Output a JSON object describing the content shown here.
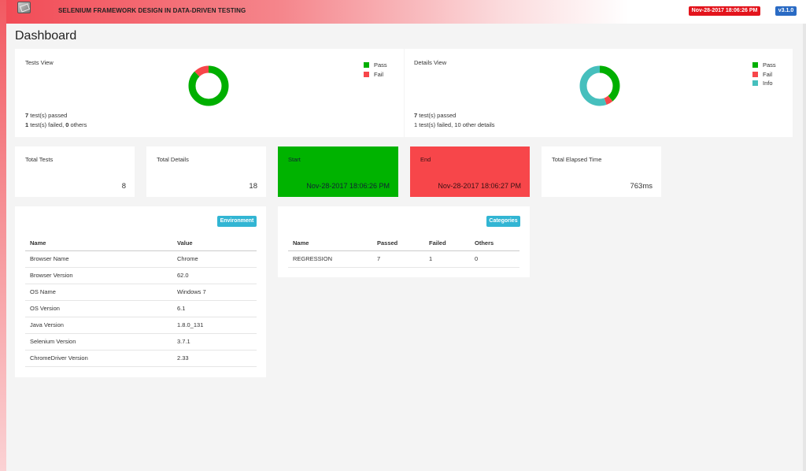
{
  "header": {
    "app_title": "SELENIUM FRAMEWORK DESIGN IN DATA-DRIVEN TESTING",
    "date": "Nov-28-2017 18:06:26 PM",
    "version": "v3.1.0",
    "logo_icon": "report-logo-icon"
  },
  "page_title": "Dashboard",
  "tests_view": {
    "label": "Tests View",
    "legend": [
      {
        "label": "Pass",
        "color": "#00af00"
      },
      {
        "label": "Fail",
        "color": "#f7464a"
      }
    ],
    "chart": {
      "pass": 7,
      "fail": 1
    },
    "summary": {
      "passed_count": "7",
      "passed_text": " test(s) passed",
      "failed_count": "1",
      "failed_text": " test(s) failed, ",
      "others_count": "0",
      "others_text": " others"
    }
  },
  "details_view": {
    "label": "Details View",
    "legend": [
      {
        "label": "Pass",
        "color": "#00af00"
      },
      {
        "label": "Fail",
        "color": "#f7464a"
      },
      {
        "label": "Info",
        "color": "#46bfbd"
      }
    ],
    "chart": {
      "pass": 7,
      "fail": 1,
      "info": 10
    },
    "summary": {
      "passed_count": "7",
      "passed_text": " test(s) passed",
      "failed_line": "1 test(s) failed, 10 other details"
    }
  },
  "stats": {
    "total_tests": {
      "label": "Total Tests",
      "value": "8"
    },
    "total_details": {
      "label": "Total Details",
      "value": "18"
    },
    "start": {
      "label": "Start",
      "value": "Nov-28-2017 18:06:26 PM",
      "color": "#00b300"
    },
    "end": {
      "label": "End",
      "value": "Nov-28-2017 18:06:27 PM",
      "color": "#f7464a"
    },
    "elapsed": {
      "label": "Total Elapsed Time",
      "value": "763ms"
    }
  },
  "environment": {
    "button": "Environment",
    "headers": [
      "Name",
      "Value"
    ],
    "rows": [
      [
        "Browser Name",
        "Chrome"
      ],
      [
        "Browser Version",
        "62.0"
      ],
      [
        "OS Name",
        "Windows 7"
      ],
      [
        "OS Version",
        "6.1"
      ],
      [
        "Java Version",
        "1.8.0_131"
      ],
      [
        "Selenium Version",
        "3.7.1"
      ],
      [
        "ChromeDriver Version",
        "2.33"
      ]
    ]
  },
  "categories": {
    "button": "Categories",
    "headers": [
      "Name",
      "Passed",
      "Failed",
      "Others"
    ],
    "rows": [
      [
        "REGRESSION",
        "7",
        "1",
        "0"
      ]
    ]
  }
}
